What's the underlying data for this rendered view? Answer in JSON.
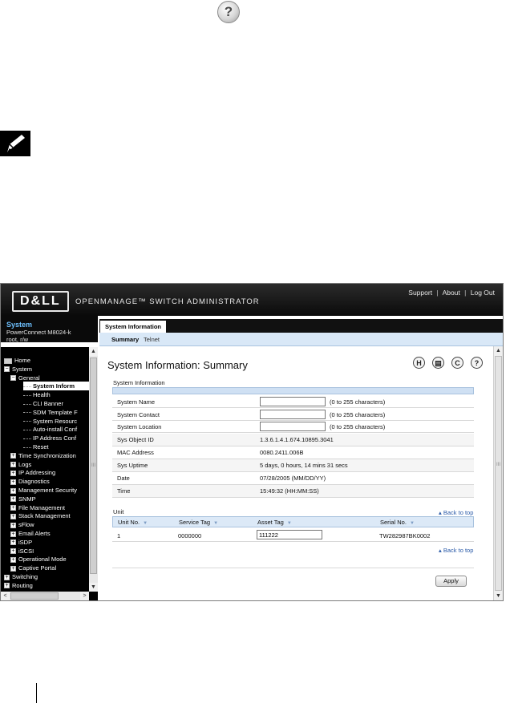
{
  "doc": {
    "help_glyph": "?",
    "note_icon": "note-pencil-icon"
  },
  "banner": {
    "logo": "D&LL",
    "product": "OPENMANAGE™ SWITCH ADMINISTRATOR",
    "links": [
      "Support",
      "About",
      "Log Out"
    ],
    "link_sep": "|"
  },
  "system": {
    "title": "System",
    "model": "PowerConnect M8024-k",
    "user": "root, r/w"
  },
  "nav": {
    "items": [
      {
        "label": "Home",
        "level": 0,
        "toggle": "",
        "icon": "home-icon"
      },
      {
        "label": "System",
        "level": 0,
        "toggle": "−"
      },
      {
        "label": "General",
        "level": 1,
        "toggle": "−"
      },
      {
        "label": "System Inform",
        "level": 2,
        "toggle": "",
        "selected": true
      },
      {
        "label": "Health",
        "level": 2,
        "toggle": ""
      },
      {
        "label": "CLI Banner",
        "level": 2,
        "toggle": ""
      },
      {
        "label": "SDM Template F",
        "level": 2,
        "toggle": ""
      },
      {
        "label": "System Resourc",
        "level": 2,
        "toggle": ""
      },
      {
        "label": "Auto-install Conf",
        "level": 2,
        "toggle": ""
      },
      {
        "label": "IP Address Conf",
        "level": 2,
        "toggle": ""
      },
      {
        "label": "Reset",
        "level": 2,
        "toggle": ""
      },
      {
        "label": "Time Synchronization",
        "level": 1,
        "toggle": "+"
      },
      {
        "label": "Logs",
        "level": 1,
        "toggle": "+"
      },
      {
        "label": "IP Addressing",
        "level": 1,
        "toggle": "+"
      },
      {
        "label": "Diagnostics",
        "level": 1,
        "toggle": "+"
      },
      {
        "label": "Management Security",
        "level": 1,
        "toggle": "+"
      },
      {
        "label": "SNMP",
        "level": 1,
        "toggle": "+"
      },
      {
        "label": "File Management",
        "level": 1,
        "toggle": "+"
      },
      {
        "label": "Stack Management",
        "level": 1,
        "toggle": "+"
      },
      {
        "label": "sFlow",
        "level": 1,
        "toggle": "+"
      },
      {
        "label": "Email Alerts",
        "level": 1,
        "toggle": "+"
      },
      {
        "label": "iSDP",
        "level": 1,
        "toggle": "+"
      },
      {
        "label": "iSCSI",
        "level": 1,
        "toggle": "+"
      },
      {
        "label": "Operational Mode",
        "level": 1,
        "toggle": "+"
      },
      {
        "label": "Captive Portal",
        "level": 1,
        "toggle": "+"
      },
      {
        "label": "Switching",
        "level": 0,
        "toggle": "+"
      },
      {
        "label": "Routing",
        "level": 0,
        "toggle": "+"
      }
    ],
    "scroll_up": "▲",
    "scroll_down": "▼",
    "scroll_left": "<",
    "scroll_right": ">",
    "grip": "III"
  },
  "tabs": {
    "main": "System Information",
    "sub": [
      "Summary",
      "Telnet"
    ]
  },
  "page": {
    "title": "System Information: Summary",
    "tools": [
      {
        "name": "save-icon",
        "glyph": "H"
      },
      {
        "name": "print-icon",
        "glyph": "▤"
      },
      {
        "name": "refresh-icon",
        "glyph": "C"
      },
      {
        "name": "help-icon",
        "glyph": "?"
      }
    ]
  },
  "sysinfo": {
    "section_label": "System Information",
    "editable_rows": [
      {
        "label": "System Name",
        "value": "",
        "hint": "(0 to 255 characters)"
      },
      {
        "label": "System Contact",
        "value": "",
        "hint": "(0 to 255 characters)"
      },
      {
        "label": "System Location",
        "value": "",
        "hint": "(0 to 255 characters)"
      }
    ],
    "static_rows": [
      {
        "label": "Sys Object ID",
        "value": "1.3.6.1.4.1.674.10895.3041"
      },
      {
        "label": "MAC Address",
        "value": "0080.2411.006B"
      },
      {
        "label": "Sys Uptime",
        "value": "5 days, 0 hours, 14 mins 31 secs"
      },
      {
        "label": "Date",
        "value": "07/28/2005  (MM/DD/YY)"
      },
      {
        "label": "Time",
        "value": "15:49:32  (HH:MM:SS)"
      }
    ]
  },
  "unit": {
    "section_label": "Unit",
    "back_to_top": "▴ Back to top",
    "columns": [
      "Unit No.",
      "Service Tag",
      "Asset Tag",
      "Serial No."
    ],
    "sort_glyph": "▼",
    "rows": [
      {
        "unit_no": "1",
        "service_tag": "0000000",
        "asset_tag": "111222",
        "serial_no": "TW282987BK0002"
      }
    ]
  },
  "apply_label": "Apply"
}
